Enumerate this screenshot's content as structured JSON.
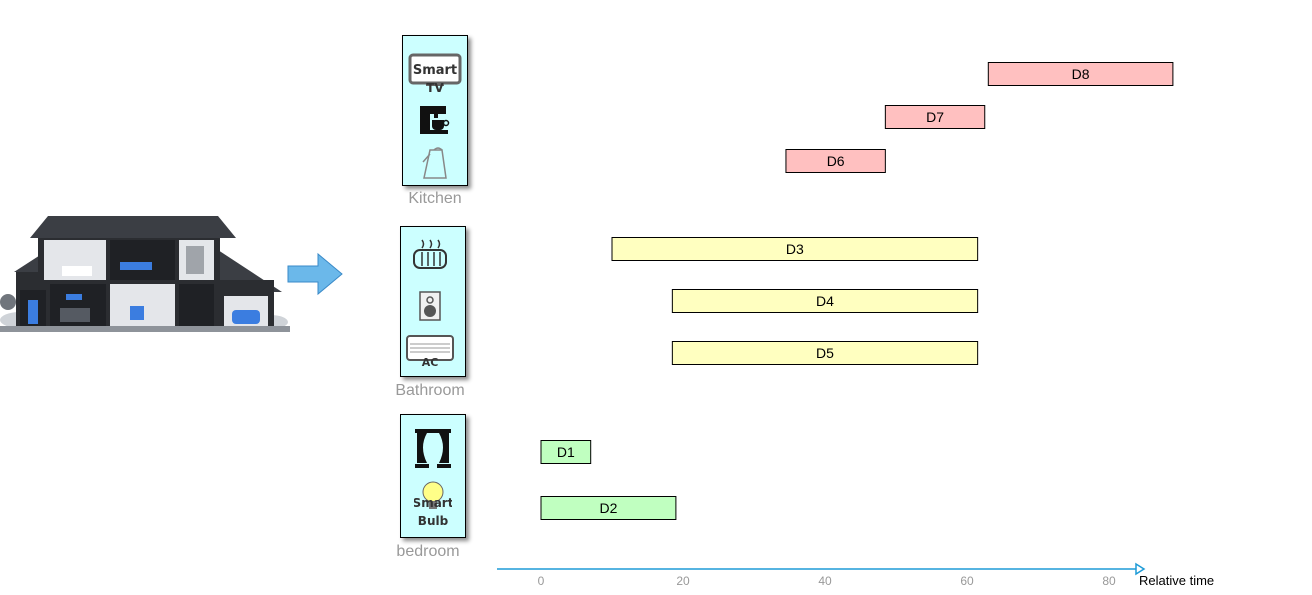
{
  "chart_data": {
    "type": "gantt",
    "xlabel": "Relative time",
    "xticks": [
      0,
      20,
      40,
      60,
      80
    ],
    "groups": [
      {
        "name": "Kitchen",
        "devices": [
          {
            "label": "D8",
            "start": 63,
            "end": 89,
            "icon": "smart-tv-icon"
          },
          {
            "label": "D7",
            "start": 48.5,
            "end": 62.5,
            "icon": "coffee-machine-icon"
          },
          {
            "label": "D6",
            "start": 34.5,
            "end": 48.5,
            "icon": "kettle-icon"
          }
        ],
        "color": "#ffc0c0"
      },
      {
        "name": "Bathroom",
        "devices": [
          {
            "label": "D3",
            "start": 10,
            "end": 61.5,
            "icon": "heater-icon"
          },
          {
            "label": "D4",
            "start": 18.5,
            "end": 61.5,
            "icon": "speaker-icon"
          },
          {
            "label": "D5",
            "start": 18.5,
            "end": 61.5,
            "icon": "ac-icon"
          }
        ],
        "color": "#ffffc0"
      },
      {
        "name": "bedroom",
        "devices": [
          {
            "label": "D1",
            "start": 0,
            "end": 7,
            "icon": "curtain-icon"
          },
          {
            "label": "D2",
            "start": 0,
            "end": 19,
            "icon": "smart-bulb-icon"
          }
        ],
        "color": "#c0ffc0"
      }
    ]
  },
  "rooms": {
    "kitchen": {
      "label": "Kitchen"
    },
    "bathroom": {
      "label": "Bathroom"
    },
    "bedroom": {
      "label": "bedroom"
    }
  },
  "icons": {
    "smart_tv_text": "Smart",
    "smart_tv_sub": "TV",
    "ac_text": "AC",
    "smart_bulb_text_1": "Smart",
    "smart_bulb_text_2": "Bulb"
  },
  "colors": {
    "kitchen_bar": "#ffc0c0",
    "bathroom_bar": "#ffffc0",
    "bedroom_bar": "#c0ffc0",
    "room_box": "#ccffff",
    "axis": "#1e9bd7",
    "arrow": "#6bb8ea"
  }
}
